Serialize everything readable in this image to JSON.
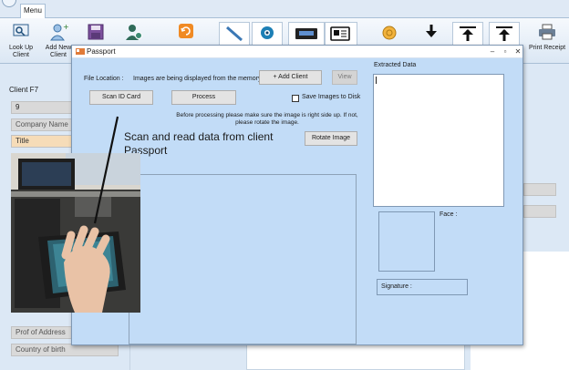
{
  "menu": {
    "tab_label": "Menu"
  },
  "ribbon": {
    "lookup_label": "Look Up Client",
    "new_client_label": "Add New Client",
    "print_receipt_label": "Print Receipt"
  },
  "client_panel": {
    "header": "Client F7",
    "fields": {
      "id_value": "9",
      "company_name": "Company Name",
      "title": "Title",
      "proof_of_address": "Prof of Address",
      "country_of_birth": "Country of birth"
    }
  },
  "dialog": {
    "title": "Passport",
    "file_location_label": "File Location :",
    "memory_status": "Images are being displayed from the memory",
    "add_client_button": "+ Add Client",
    "view_button": "View",
    "scan_id_button": "Scan ID Card",
    "process_button": "Process",
    "save_images_label": "Save Images to Disk",
    "save_images_checked": false,
    "note_text": "Before processing please make sure the image is right side up. If not, please rotate the image.",
    "rotate_button": "Rotate Image",
    "extracted_label": "Extracted Data",
    "face_label": "Face :",
    "signature_label": "Signature :"
  },
  "annotation": {
    "line1": "Scan and read data from client",
    "line2": "Passport"
  },
  "colors": {
    "dialog_bg": "#c2dcf7",
    "app_bg": "#dce8f5",
    "selected_field": "#f6dcb8",
    "accent_orange": "#f08a24"
  }
}
